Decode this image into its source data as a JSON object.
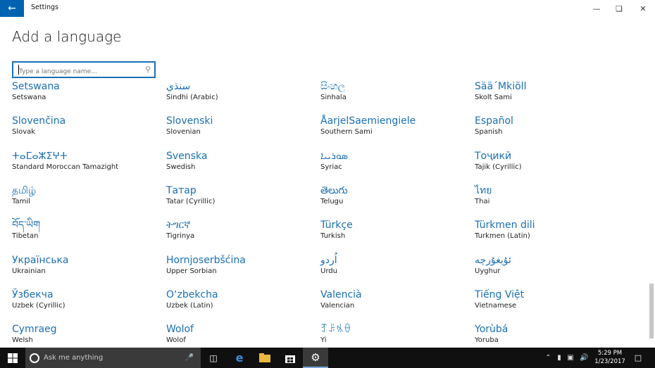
{
  "window": {
    "title": "Settings"
  },
  "page": {
    "title": "Add a language"
  },
  "search": {
    "placeholder": "Type a language name..."
  },
  "languages": [
    {
      "native": "Setswana",
      "english": "Setswana"
    },
    {
      "native": "سنڌي",
      "english": "Sindhi (Arabic)"
    },
    {
      "native": "සිංහල",
      "english": "Sinhala"
    },
    {
      "native": "Sää´Mkiõll",
      "english": "Skolt Sami"
    },
    {
      "native": "Slovenčina",
      "english": "Slovak"
    },
    {
      "native": "Slovenski",
      "english": "Slovenian"
    },
    {
      "native": "ÅarjelSaemiengiele",
      "english": "Southern Sami"
    },
    {
      "native": "Español",
      "english": "Spanish"
    },
    {
      "native": "ⵜⴰⵎⴰⵣⵉⵖⵜ",
      "english": "Standard Moroccan Tamazight"
    },
    {
      "native": "Svenska",
      "english": "Swedish"
    },
    {
      "native": "ܣܘܪܝܝܐ",
      "english": "Syriac"
    },
    {
      "native": "Тоҷикӣ",
      "english": "Tajik (Cyrillic)"
    },
    {
      "native": "தமிழ்",
      "english": "Tamil"
    },
    {
      "native": "Татар",
      "english": "Tatar (Cyrillic)"
    },
    {
      "native": "తెలుగు",
      "english": "Telugu"
    },
    {
      "native": "ไทย",
      "english": "Thai"
    },
    {
      "native": "བོད་ཡིག",
      "english": "Tibetan"
    },
    {
      "native": "ትግርኛ",
      "english": "Tigrinya"
    },
    {
      "native": "Türkçe",
      "english": "Turkish"
    },
    {
      "native": "Türkmen dili",
      "english": "Turkmen (Latin)"
    },
    {
      "native": "Українська",
      "english": "Ukrainian"
    },
    {
      "native": "Hornjoserbšćina",
      "english": "Upper Sorbian"
    },
    {
      "native": "اُردو",
      "english": "Urdu"
    },
    {
      "native": "ئۇيغۇرچە",
      "english": "Uyghur"
    },
    {
      "native": "Ўзбекча",
      "english": "Uzbek (Cyrillic)"
    },
    {
      "native": "O‘zbekcha",
      "english": "Uzbek (Latin)"
    },
    {
      "native": "Valencià",
      "english": "Valencian"
    },
    {
      "native": "Tiếng Việt",
      "english": "Vietnamese"
    },
    {
      "native": "Cymraeg",
      "english": "Welsh"
    },
    {
      "native": "Wolof",
      "english": "Wolof"
    },
    {
      "native": "ꆈꌠꁱꂷ",
      "english": "Yi"
    },
    {
      "native": "Yorùbá",
      "english": "Yoruba"
    }
  ],
  "taskbar": {
    "search_placeholder": "Ask me anything",
    "time": "5:29 PM",
    "date": "1/23/2017"
  },
  "colors": {
    "accent": "#0063b1",
    "link": "#1a6fb3",
    "taskbar": "#101010"
  }
}
